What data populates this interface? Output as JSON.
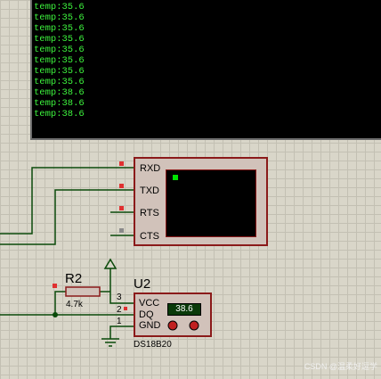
{
  "terminal": {
    "lines": [
      "temp:35.6",
      "temp:35.6",
      "temp:35.6",
      "temp:35.6",
      "temp:35.6",
      "temp:35.6",
      "temp:35.6",
      "temp:35.6",
      "temp:38.6",
      "temp:38.6",
      "temp:38.6"
    ]
  },
  "virtual_terminal": {
    "pins": [
      "RXD",
      "TXD",
      "RTS",
      "CTS"
    ]
  },
  "resistor": {
    "ref": "R2",
    "value": "4.7k"
  },
  "sensor": {
    "ref": "U2",
    "part": "DS18B20",
    "reading": "38.6",
    "pins": [
      "VCC",
      "DQ",
      "GND"
    ],
    "pin_numbers": [
      "3",
      "2",
      "1"
    ]
  },
  "watermark": "CSDN @温柔好逗学",
  "colors": {
    "wire": "#0a4a0a",
    "part_border": "#8b1a1a",
    "part_fill": "#d1c2ba",
    "pin_red": "#e03030",
    "terminal_text": "#3df23d"
  }
}
